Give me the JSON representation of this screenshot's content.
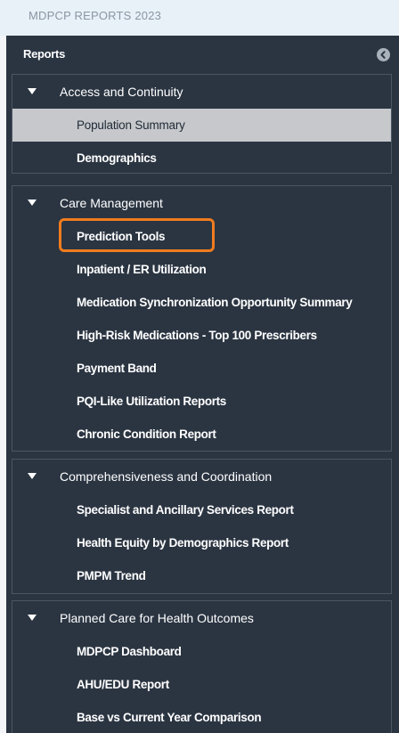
{
  "topbar": {
    "title": "MDPCP REPORTS 2023"
  },
  "panel": {
    "title": "Reports",
    "collapse_icon": "chevron-left-circle-icon"
  },
  "sections": [
    {
      "label": "Access and Continuity",
      "items": [
        {
          "label": "Population Summary",
          "selected": true
        },
        {
          "label": "Demographics"
        }
      ]
    },
    {
      "label": "Care Management",
      "items": [
        {
          "label": "Prediction Tools",
          "highlighted": true
        },
        {
          "label": "Inpatient / ER Utilization"
        },
        {
          "label": "Medication Synchronization Opportunity Summary"
        },
        {
          "label": "High-Risk Medications - Top 100 Prescribers"
        },
        {
          "label": "Payment Band"
        },
        {
          "label": "PQI-Like Utilization Reports"
        },
        {
          "label": "Chronic Condition Report"
        }
      ]
    },
    {
      "label": "Comprehensiveness and Coordination",
      "items": [
        {
          "label": "Specialist and Ancillary Services Report"
        },
        {
          "label": "Health Equity by Demographics Report"
        },
        {
          "label": "PMPM Trend"
        }
      ]
    },
    {
      "label": "Planned Care for Health Outcomes",
      "items": [
        {
          "label": "MDPCP Dashboard"
        },
        {
          "label": "AHU/EDU Report"
        },
        {
          "label": "Base vs Current Year Comparison"
        }
      ]
    }
  ],
  "colors": {
    "panel_bg": "#2b3542",
    "selected_bg": "#c6c8cb",
    "highlight": "#f07c1e",
    "topbar_bg": "#e8f1f8"
  }
}
